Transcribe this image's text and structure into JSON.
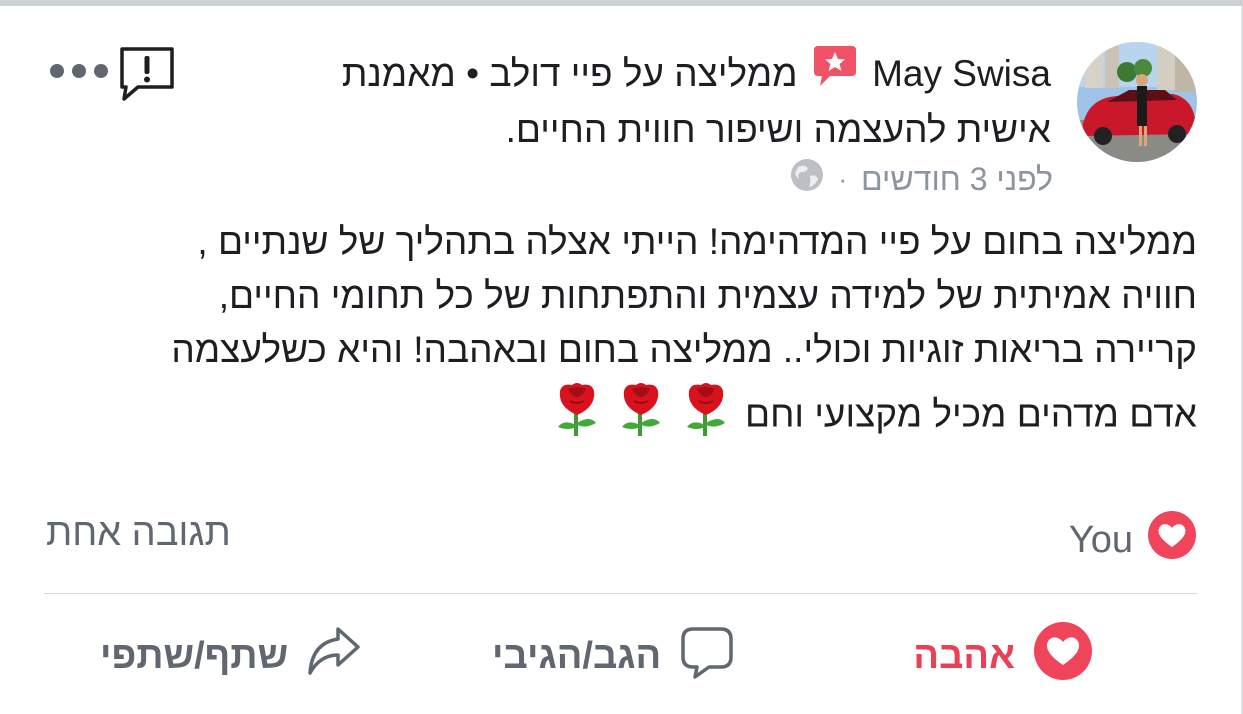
{
  "post": {
    "author": "May Swisa",
    "headline_rest": "ממליצה על פיי דולב • מאמנת אישית להעצמה ושיפור חווית החיים.",
    "time": "לפני 3 חודשים",
    "meta_separator": "·",
    "body": [
      "ממליצה בחום על פיי המדהימה! הייתי אצלה בתהליך של שנתיים ,",
      "חוויה אמיתית של למידה עצמית והתפתחות של כל תחומי החיים,",
      "קריירה בריאות זוגיות וכולי.. ממליצה בחום ובאהבה! והיא כשלעצמה",
      "אדם מדהים מכיל מקצועי וחם"
    ],
    "emoji_count": 3,
    "icons": {
      "recommend": "recommend-badge-icon",
      "privacy": "globe-icon",
      "report": "report-icon",
      "more": "more-icon"
    }
  },
  "reactions": {
    "summary": "You",
    "comments": "תגובה אחת"
  },
  "actions": {
    "love": "אהבה",
    "comment": "הגב/הגיבי",
    "share": "שתף/שתפי"
  },
  "colors": {
    "love": "#e94053",
    "secondary_text": "#606770",
    "meta_text": "#8d949e",
    "divider": "#d5d8dc"
  }
}
